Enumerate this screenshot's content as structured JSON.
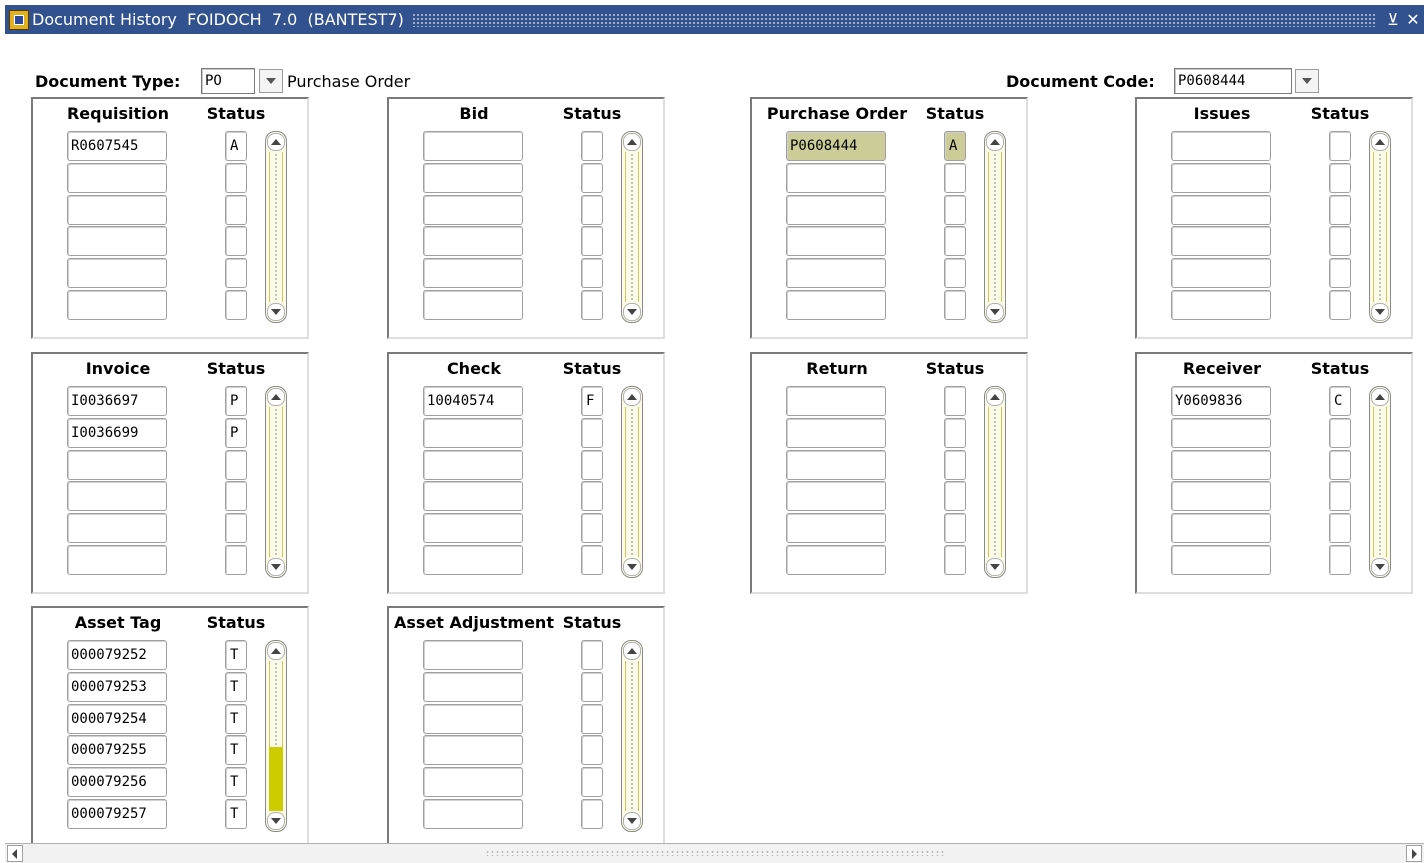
{
  "window": {
    "title": "Document History  FOIDOCH  7.0  (BANTEST7)",
    "minimize_glyph": "⊻",
    "close_glyph": "✕",
    "app_icon": "banner-app-icon"
  },
  "header": {
    "doc_type_label": "Document Type:",
    "doc_type_value": "PO",
    "doc_type_desc": "Purchase Order",
    "doc_code_label": "Document Code:",
    "doc_code_value": "P0608444"
  },
  "blocks": [
    {
      "key": "requisition",
      "title": "Requisition",
      "status_title": "Status",
      "rows": [
        {
          "code": "R0607545",
          "status": "A"
        },
        {
          "code": "",
          "status": ""
        },
        {
          "code": "",
          "status": ""
        },
        {
          "code": "",
          "status": ""
        },
        {
          "code": "",
          "status": ""
        },
        {
          "code": "",
          "status": ""
        }
      ]
    },
    {
      "key": "bid",
      "title": "Bid",
      "status_title": "Status",
      "rows": [
        {
          "code": "",
          "status": ""
        },
        {
          "code": "",
          "status": ""
        },
        {
          "code": "",
          "status": ""
        },
        {
          "code": "",
          "status": ""
        },
        {
          "code": "",
          "status": ""
        },
        {
          "code": "",
          "status": ""
        }
      ]
    },
    {
      "key": "purchase-order",
      "title": "Purchase Order",
      "status_title": "Status",
      "selected_row": 0,
      "rows": [
        {
          "code": "P0608444",
          "status": "A"
        },
        {
          "code": "",
          "status": ""
        },
        {
          "code": "",
          "status": ""
        },
        {
          "code": "",
          "status": ""
        },
        {
          "code": "",
          "status": ""
        },
        {
          "code": "",
          "status": ""
        }
      ]
    },
    {
      "key": "issues",
      "title": "Issues",
      "status_title": "Status",
      "rows": [
        {
          "code": "",
          "status": ""
        },
        {
          "code": "",
          "status": ""
        },
        {
          "code": "",
          "status": ""
        },
        {
          "code": "",
          "status": ""
        },
        {
          "code": "",
          "status": ""
        },
        {
          "code": "",
          "status": ""
        }
      ]
    },
    {
      "key": "invoice",
      "title": "Invoice",
      "status_title": "Status",
      "rows": [
        {
          "code": "I0036697",
          "status": "P"
        },
        {
          "code": "I0036699",
          "status": "P"
        },
        {
          "code": "",
          "status": ""
        },
        {
          "code": "",
          "status": ""
        },
        {
          "code": "",
          "status": ""
        },
        {
          "code": "",
          "status": ""
        }
      ]
    },
    {
      "key": "check",
      "title": "Check",
      "status_title": "Status",
      "rows": [
        {
          "code": "10040574",
          "status": "F"
        },
        {
          "code": "",
          "status": ""
        },
        {
          "code": "",
          "status": ""
        },
        {
          "code": "",
          "status": ""
        },
        {
          "code": "",
          "status": ""
        },
        {
          "code": "",
          "status": ""
        }
      ]
    },
    {
      "key": "return",
      "title": "Return",
      "status_title": "Status",
      "rows": [
        {
          "code": "",
          "status": ""
        },
        {
          "code": "",
          "status": ""
        },
        {
          "code": "",
          "status": ""
        },
        {
          "code": "",
          "status": ""
        },
        {
          "code": "",
          "status": ""
        },
        {
          "code": "",
          "status": ""
        }
      ]
    },
    {
      "key": "receiver",
      "title": "Receiver",
      "status_title": "Status",
      "rows": [
        {
          "code": "Y0609836",
          "status": "C"
        },
        {
          "code": "",
          "status": ""
        },
        {
          "code": "",
          "status": ""
        },
        {
          "code": "",
          "status": ""
        },
        {
          "code": "",
          "status": ""
        },
        {
          "code": "",
          "status": ""
        }
      ]
    },
    {
      "key": "asset-tag",
      "title": "Asset Tag",
      "status_title": "Status",
      "scroll_thumb": {
        "start": 0.57,
        "end": 1.0
      },
      "rows": [
        {
          "code": "000079252",
          "status": "T"
        },
        {
          "code": "000079253",
          "status": "T"
        },
        {
          "code": "000079254",
          "status": "T"
        },
        {
          "code": "000079255",
          "status": "T"
        },
        {
          "code": "000079256",
          "status": "T"
        },
        {
          "code": "000079257",
          "status": "T"
        }
      ]
    },
    {
      "key": "asset-adjustment",
      "title": "Asset Adjustment",
      "status_title": "Status",
      "rows": [
        {
          "code": "",
          "status": ""
        },
        {
          "code": "",
          "status": ""
        },
        {
          "code": "",
          "status": ""
        },
        {
          "code": "",
          "status": ""
        },
        {
          "code": "",
          "status": ""
        },
        {
          "code": "",
          "status": ""
        }
      ]
    }
  ],
  "colors": {
    "titlebar": "#31528e",
    "selected_field": "#cccc99",
    "scroll_thumb": "#cccc00"
  }
}
